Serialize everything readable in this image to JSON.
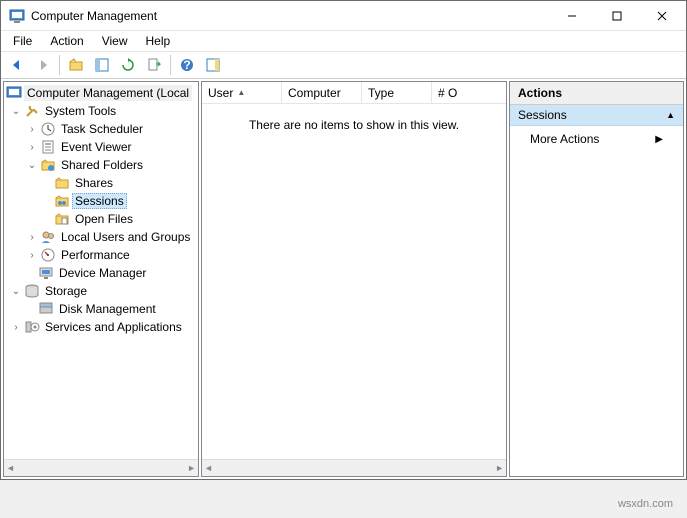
{
  "window": {
    "title": "Computer Management"
  },
  "menu": {
    "file": "File",
    "action": "Action",
    "view": "View",
    "help": "Help"
  },
  "tree": {
    "root": "Computer Management (Local",
    "system_tools": "System Tools",
    "task_scheduler": "Task Scheduler",
    "event_viewer": "Event Viewer",
    "shared_folders": "Shared Folders",
    "shares": "Shares",
    "sessions": "Sessions",
    "open_files": "Open Files",
    "local_users": "Local Users and Groups",
    "performance": "Performance",
    "device_manager": "Device Manager",
    "storage": "Storage",
    "disk_management": "Disk Management",
    "services_apps": "Services and Applications"
  },
  "list": {
    "cols": {
      "user": "User",
      "computer": "Computer",
      "type": "Type",
      "open": "# O"
    },
    "empty": "There are no items to show in this view."
  },
  "actions": {
    "header": "Actions",
    "section": "Sessions",
    "more": "More Actions"
  },
  "watermark": "wsxdn.com"
}
